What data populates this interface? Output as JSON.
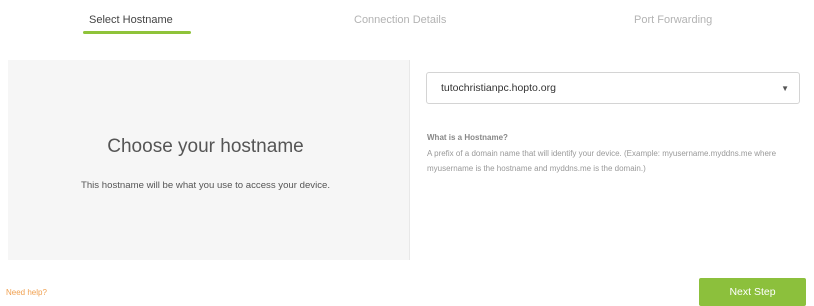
{
  "steps": {
    "tabs": [
      {
        "label": "Select Hostname",
        "active": true
      },
      {
        "label": "Connection Details",
        "active": false
      },
      {
        "label": "Port Forwarding",
        "active": false
      }
    ]
  },
  "left_panel": {
    "title": "Choose your hostname",
    "subtitle": "This hostname will be what you use to access your device."
  },
  "hostname_select": {
    "selected_value": "tutochristianpc.hopto.org",
    "caret_icon": "caret-down-icon"
  },
  "help_box": {
    "title": "What is a Hostname?",
    "text": "A prefix of a domain name that will identify your device. (Example: myusername.myddns.me where myusername is the hostname and myddns.me is the domain.)"
  },
  "footer": {
    "help_link": "Need help?",
    "next_button": "Next Step"
  },
  "colors": {
    "accent": "#8fc33a",
    "button": "#8cc03c",
    "help_link": "#f0a050",
    "panel_bg": "#f6f6f6"
  }
}
